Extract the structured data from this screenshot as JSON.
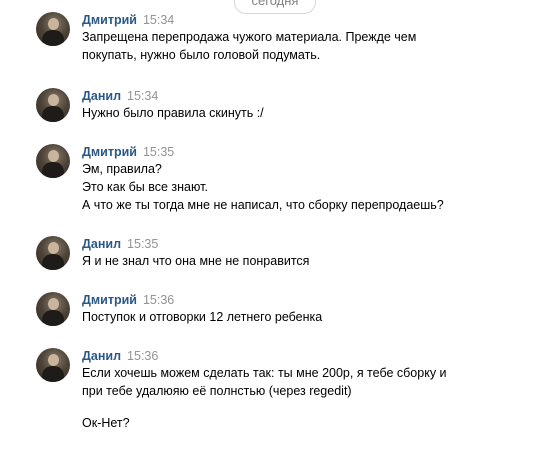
{
  "date_divider": "сегодня",
  "messages": [
    {
      "author": "Дмитрий",
      "time": "15:34",
      "lines": [
        "Запрещена перепродажа чужого материала. Прежде чем",
        "покупать, нужно было головой подумать."
      ]
    },
    {
      "author": "Данил",
      "time": "15:34",
      "lines": [
        "Нужно было правила скинуть :/"
      ]
    },
    {
      "author": "Дмитрий",
      "time": "15:35",
      "lines": [
        "Эм, правила?",
        "Это как бы все знают.",
        "А что же ты тогда мне не написал, что сборку перепродаешь?"
      ]
    },
    {
      "author": "Данил",
      "time": "15:35",
      "lines": [
        "Я и не знал что она мне не понравится"
      ]
    },
    {
      "author": "Дмитрий",
      "time": "15:36",
      "lines": [
        "Поступок и отговорки 12 летнего ребенка"
      ]
    },
    {
      "author": "Данил",
      "time": "15:36",
      "lines": [
        "Если хочешь можем сделать так: ты мне 200р, я тебе сборку и",
        "при тебе удалюяю её полнстью (через regedit)"
      ],
      "extra_line": "Ок-Нет?"
    }
  ]
}
